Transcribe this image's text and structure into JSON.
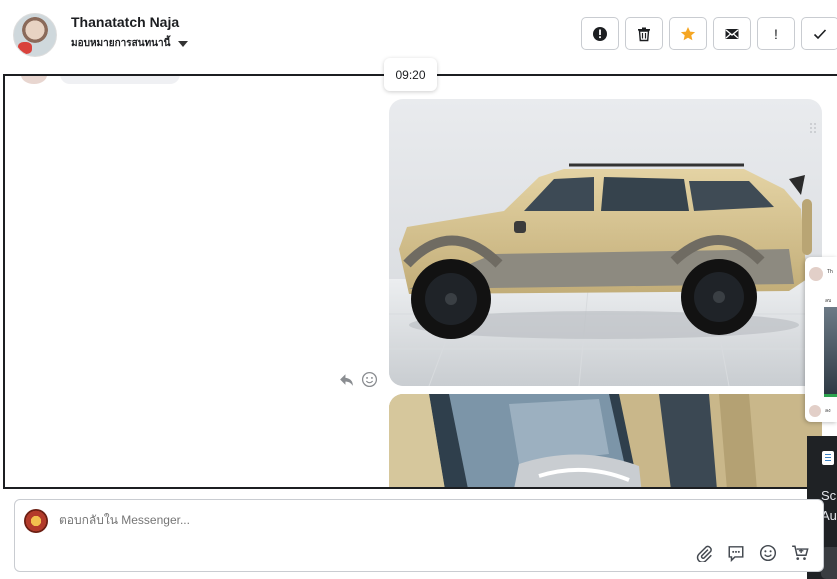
{
  "header": {
    "contact_name": "Thanatatch Naja",
    "assign_label": "มอบหมายการสนทนานี้"
  },
  "toolbar": {
    "buttons": [
      {
        "icon": "alert-circle-icon"
      },
      {
        "icon": "trash-icon"
      },
      {
        "icon": "star-icon",
        "color": "#f5a623"
      },
      {
        "icon": "envelope-icon"
      },
      {
        "icon": "exclamation-icon",
        "glyph": "!"
      },
      {
        "icon": "check-icon"
      }
    ]
  },
  "messages": {
    "timestamp": "09:20",
    "photos": [
      {
        "subject": "gold suv side view"
      },
      {
        "subject": "gold suv side mirror close-up"
      }
    ]
  },
  "composer": {
    "placeholder": "ตอบกลับใน Messenger..."
  },
  "side_overlay": {
    "line1": "Th",
    "line2": "ลบ",
    "line3": "ลง"
  },
  "dark_panel": {
    "line1": "Sc",
    "line2": "Au"
  },
  "colors": {
    "accent_star": "#f5a623",
    "border_dark": "#1c1e21",
    "border_light": "#c9ccd1"
  }
}
